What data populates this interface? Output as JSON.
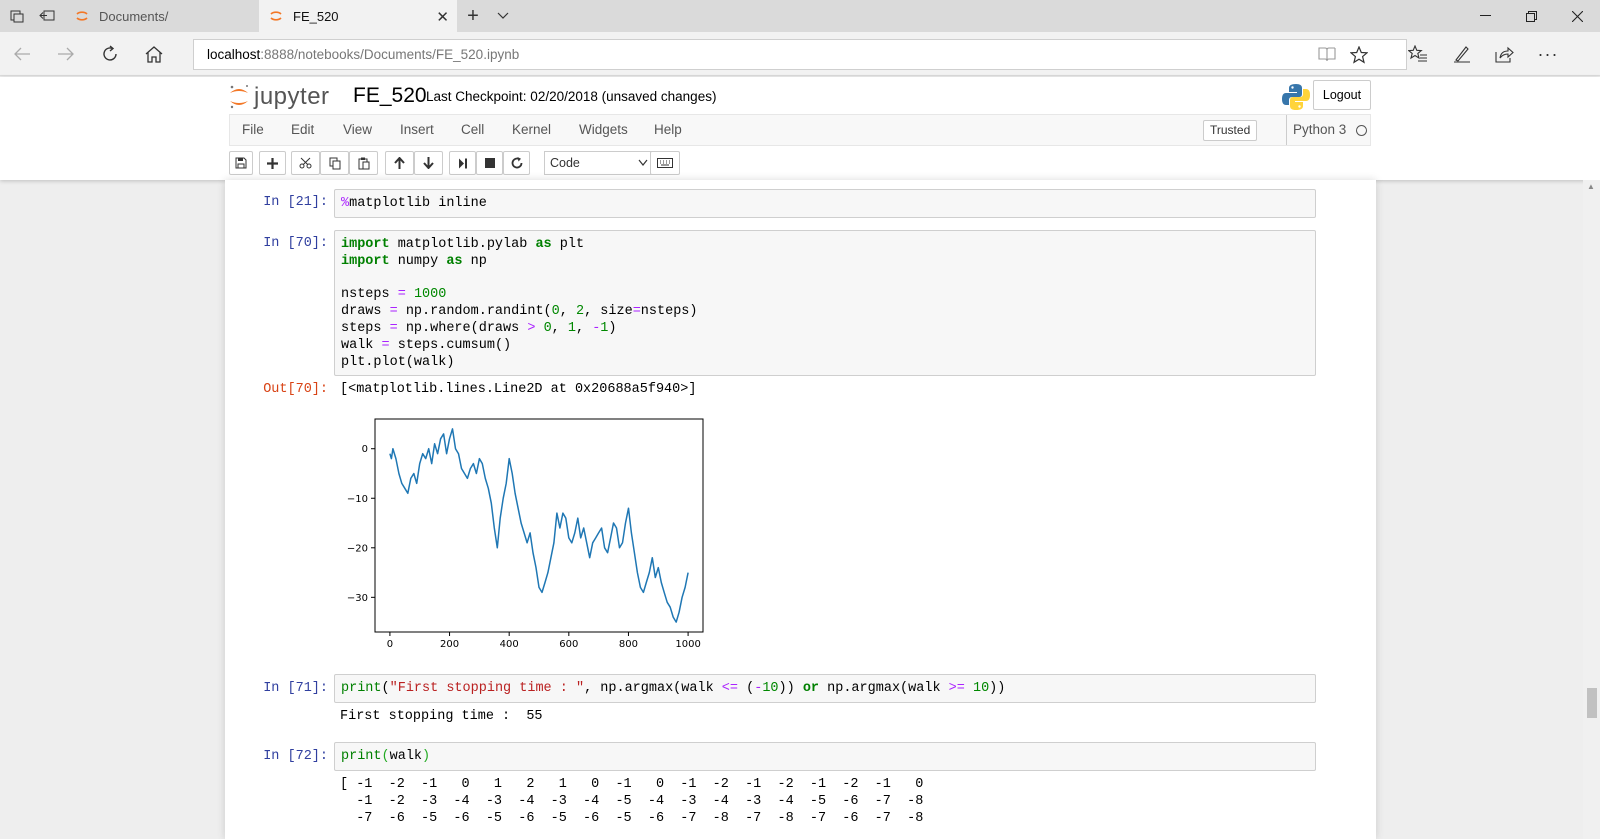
{
  "browser": {
    "tabs": [
      {
        "title": "Documents/",
        "active": false
      },
      {
        "title": "FE_520",
        "active": true
      }
    ],
    "address": {
      "host": "localhost",
      "path": ":8888/notebooks/Documents/FE_520.ipynb"
    },
    "icons": [
      "tab-list-icon",
      "back-tabs-icon",
      "back-icon",
      "forward-icon",
      "refresh-icon",
      "home-icon",
      "reading-view-icon",
      "favorite-star-icon",
      "favorites-hub-icon",
      "pen-icon",
      "share-icon",
      "more-icon",
      "new-tab-icon",
      "tab-dropdown-icon",
      "minimize-icon",
      "restore-icon",
      "close-window-icon"
    ]
  },
  "jupyter": {
    "logo_text": "jupyter",
    "notebook_name": "FE_520",
    "checkpoint": "Last Checkpoint: 02/20/2018 (unsaved changes)",
    "logout": "Logout",
    "menu": [
      "File",
      "Edit",
      "View",
      "Insert",
      "Cell",
      "Kernel",
      "Widgets",
      "Help"
    ],
    "trusted": "Trusted",
    "kernel": "Python 3",
    "cell_type": "Code",
    "toolbar_icons": [
      "save-icon",
      "add-cell-icon",
      "cut-icon",
      "copy-icon",
      "paste-icon",
      "move-up-icon",
      "move-down-icon",
      "run-icon",
      "stop-icon",
      "restart-icon",
      "keyboard-icon"
    ]
  },
  "cells": {
    "c21": {
      "prompt": "In [21]:"
    },
    "c70": {
      "prompt": "In [70]:",
      "out_prompt": "Out[70]:",
      "output_text": "[<matplotlib.lines.Line2D at 0x20688a5f940>]"
    },
    "c71": {
      "prompt": "In [71]:",
      "output_text": "First stopping time :  55"
    },
    "c72": {
      "prompt": "In [72]:"
    }
  },
  "array_output": [
    "[ -1  -2  -1   0   1   2   1   0  -1   0  -1  -2  -1  -2  -1  -2  -1   0",
    "  -1  -2  -3  -4  -3  -4  -3  -4  -5  -4  -3  -4  -3  -4  -5  -6  -7  -8",
    "  -7  -6  -5  -6  -5  -6  -5  -6  -5  -6  -7  -8  -7  -8  -7  -6  -7  -8"
  ],
  "chart_data": {
    "type": "line",
    "title": "",
    "xlabel": "",
    "ylabel": "",
    "xlim": [
      -50,
      1050
    ],
    "ylim": [
      -37,
      6
    ],
    "xticks": [
      0,
      200,
      400,
      600,
      800,
      1000
    ],
    "yticks": [
      0,
      -10,
      -20,
      -30
    ],
    "series_color": "#1f77b4",
    "x": [
      0,
      5,
      10,
      20,
      30,
      40,
      50,
      60,
      70,
      80,
      90,
      100,
      110,
      120,
      130,
      140,
      150,
      160,
      170,
      180,
      190,
      200,
      210,
      220,
      230,
      240,
      250,
      260,
      270,
      280,
      290,
      300,
      310,
      320,
      330,
      340,
      350,
      360,
      370,
      380,
      390,
      400,
      410,
      420,
      430,
      440,
      450,
      460,
      470,
      480,
      490,
      500,
      510,
      520,
      530,
      540,
      550,
      560,
      570,
      580,
      590,
      600,
      610,
      620,
      630,
      640,
      650,
      660,
      670,
      680,
      690,
      700,
      710,
      720,
      730,
      740,
      750,
      760,
      770,
      780,
      790,
      800,
      810,
      820,
      830,
      840,
      850,
      860,
      870,
      880,
      890,
      900,
      910,
      920,
      930,
      940,
      950,
      960,
      970,
      980,
      990,
      1000
    ],
    "y": [
      -1,
      -2,
      0,
      -2,
      -5,
      -7,
      -8,
      -9,
      -6,
      -5,
      -7,
      -3,
      -1,
      -2,
      0,
      -3,
      1,
      -1,
      2,
      3,
      -1,
      2,
      4,
      0,
      -1,
      -4,
      -5,
      -6,
      -4,
      -3,
      -5,
      -2,
      -3,
      -6,
      -8,
      -11,
      -16,
      -20,
      -14,
      -10,
      -7,
      -2,
      -5,
      -9,
      -12,
      -15,
      -17,
      -19,
      -17,
      -21,
      -24,
      -28,
      -29,
      -27,
      -25,
      -22,
      -19,
      -13,
      -16,
      -13,
      -14,
      -18,
      -19,
      -17,
      -14,
      -18,
      -16,
      -19,
      -22,
      -19,
      -18,
      -17,
      -16,
      -20,
      -21,
      -18,
      -15,
      -16,
      -20,
      -19,
      -15,
      -12,
      -17,
      -21,
      -25,
      -28,
      -29,
      -27,
      -25,
      -22,
      -26,
      -24,
      -27,
      -29,
      -31,
      -32,
      -34,
      -35,
      -33,
      -30,
      -28,
      -25
    ]
  }
}
